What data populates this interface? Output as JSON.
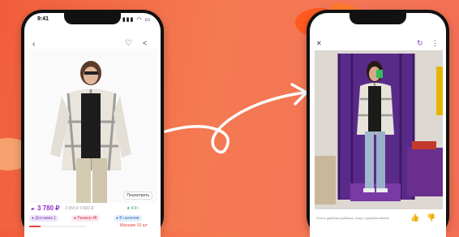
{
  "left_phone": {
    "status_time": "9:41",
    "status_icons": "▮▮▮ ◠ ▭",
    "badge": "Посмотреть",
    "price": "3 780 ₽",
    "price_old": "3 950 ₽ 4 500 ₽",
    "rating": "★ 4.8 ›",
    "chips": [
      "● Доставка 1",
      "● Размер 48",
      "● В наличии"
    ],
    "promo": "Магазин 10 шт"
  },
  "right_phone": {
    "caption_line": "Очень удобная рубашка, ношу с удовольствием"
  },
  "colors": {
    "background": "#f25d3b",
    "accent_purple": "#7a3db8",
    "price_purple": "#8b2fc9"
  }
}
